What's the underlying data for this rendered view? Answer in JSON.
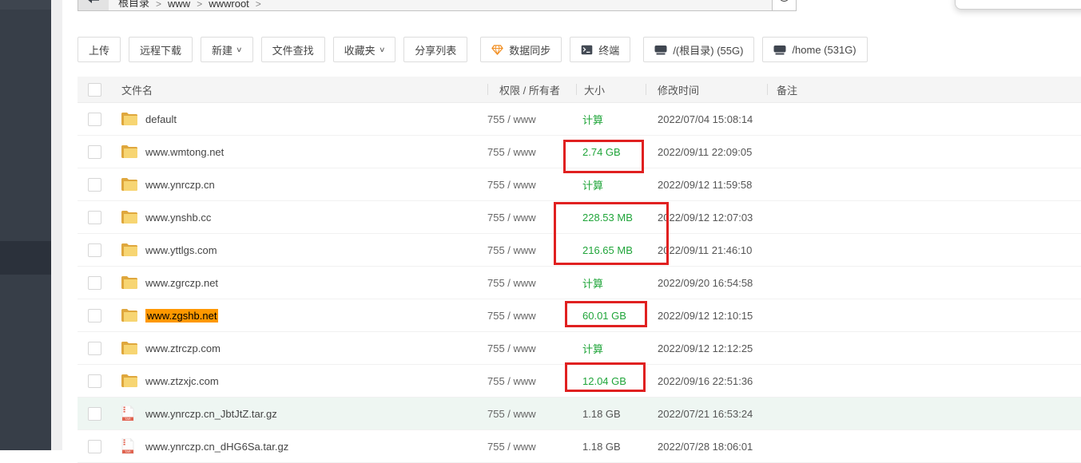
{
  "topbar": {
    "breadcrumb": [
      "根目录",
      "www",
      "wwwroot"
    ],
    "separator": ">"
  },
  "toolbar": {
    "upload": "上传",
    "remote_download": "远程下载",
    "new": "新建",
    "file_search": "文件查找",
    "favorites": "收藏夹",
    "share_list": "分享列表",
    "data_sync": "数据同步",
    "terminal": "终端",
    "disk_root": "/(根目录) (55G)",
    "disk_home": "/home (531G)",
    "caret": "∨"
  },
  "table": {
    "headers": {
      "name": "文件名",
      "perm": "权限 / 所有者",
      "size": "大小",
      "mtime": "修改时间",
      "note": "备注"
    },
    "rows": [
      {
        "name": "default",
        "icon": "folder",
        "perm": "755 / www",
        "size": "计算",
        "mtime": "2022/07/04 15:08:14"
      },
      {
        "name": "www.wmtong.net",
        "icon": "folder",
        "perm": "755 / www",
        "size": "2.74 GB",
        "mtime": "2022/09/11 22:09:05"
      },
      {
        "name": "www.ynrczp.cn",
        "icon": "folder",
        "perm": "755 / www",
        "size": "计算",
        "mtime": "2022/09/12 11:59:58"
      },
      {
        "name": "www.ynshb.cc",
        "icon": "folder",
        "perm": "755 / www",
        "size": "228.53 MB",
        "mtime": "2022/09/12 12:07:03"
      },
      {
        "name": "www.yttlgs.com",
        "icon": "folder",
        "perm": "755 / www",
        "size": "216.65 MB",
        "mtime": "2022/09/11 21:46:10"
      },
      {
        "name": "www.zgrczp.net",
        "icon": "folder",
        "perm": "755 / www",
        "size": "计算",
        "mtime": "2022/09/20 16:54:58"
      },
      {
        "name": "www.zgshb.net",
        "icon": "folder",
        "perm": "755 / www",
        "size": "60.01 GB",
        "mtime": "2022/09/12 12:10:15"
      },
      {
        "name": "www.ztrczp.com",
        "icon": "folder",
        "perm": "755 / www",
        "size": "计算",
        "mtime": "2022/09/12 12:12:25"
      },
      {
        "name": "www.ztzxjc.com",
        "icon": "folder",
        "perm": "755 / www",
        "size": "12.04 GB",
        "mtime": "2022/09/16 22:51:36"
      },
      {
        "name": "www.ynrczp.cn_JbtJtZ.tar.gz",
        "icon": "tar",
        "perm": "755 / www",
        "size": "1.18 GB",
        "mtime": "2022/07/21 16:53:24"
      },
      {
        "name": "www.ynrczp.cn_dHG6Sa.tar.gz",
        "icon": "tar",
        "perm": "755 / www",
        "size": "1.18 GB",
        "mtime": "2022/07/28 18:06:01"
      }
    ]
  },
  "colors": {
    "green_link": "#20a53a",
    "annotation_red": "#e02020",
    "selection_orange": "#ff9800",
    "sidebar_dark": "#373e48"
  }
}
